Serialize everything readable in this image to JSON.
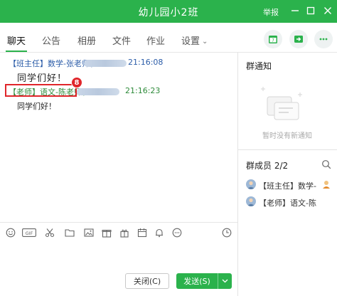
{
  "window": {
    "title": "幼儿园小2班",
    "report_label": "举报",
    "colors": {
      "brand": "#2bb24c",
      "highlight": "#e0262b"
    }
  },
  "tabs": [
    {
      "label": "聊天"
    },
    {
      "label": "公告"
    },
    {
      "label": "相册"
    },
    {
      "label": "文件"
    },
    {
      "label": "作业"
    },
    {
      "label": "设置"
    }
  ],
  "toolbar_icons": [
    "calendar-icon",
    "share-icon",
    "more-icon"
  ],
  "chat": {
    "messages": [
      {
        "sender": "【班主任】数学-张老师(",
        "time": "21:16:08",
        "text": "同学们好！"
      },
      {
        "sender": "【老师】语文-陈老师(",
        "time": "21:16:23",
        "text": "同学们好！"
      }
    ],
    "annotation_number": "8"
  },
  "input_toolbar_icons": [
    "emoji-icon",
    "gif-icon",
    "scissors-icon",
    "folder-icon",
    "image-icon",
    "gift-box-icon",
    "gift-icon",
    "calendar-icon",
    "bell-icon",
    "more-dots-icon",
    "history-clock-icon"
  ],
  "gif_label": "GIF",
  "buttons": {
    "close_label": "关闭(C)",
    "send_label": "发送(S)"
  },
  "right_panel": {
    "notice_title": "群通知",
    "notice_empty": "暂时没有新通知",
    "members_title": "群成员 2/2",
    "members": [
      {
        "name": "【班主任】数学-"
      },
      {
        "name": "【老师】语文-陈"
      }
    ]
  }
}
